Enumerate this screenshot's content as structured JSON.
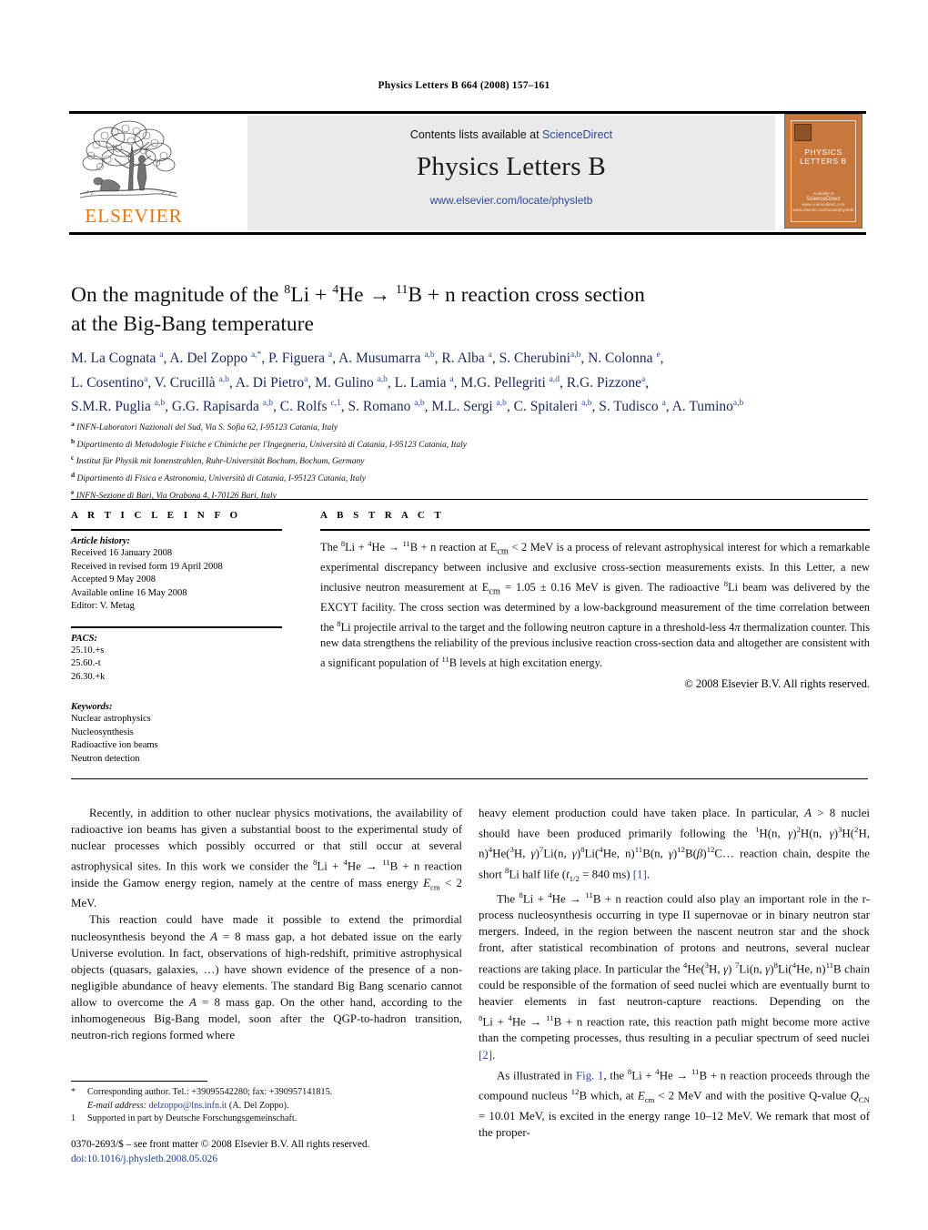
{
  "running_head": "Physics Letters B 664 (2008) 157–161",
  "masthead": {
    "publisher_name": "ELSEVIER",
    "contents_prefix": "Contents lists available at ",
    "contents_link": "ScienceDirect",
    "journal_title": "Physics Letters B",
    "journal_url": "www.elsevier.com/locate/physletb",
    "cover": {
      "title": "PHYSICS LETTERS B",
      "foot_line1": "Available at",
      "foot_line2": "ScienceDirect",
      "foot_line3": "www.sciencedirect.com",
      "foot_line4": "www.elsevier.com/locate/physletb"
    }
  },
  "article": {
    "title_line1_pre": "On the magnitude of the ",
    "title_line1_post": " reaction cross section",
    "title_line2": "at the Big-Bang temperature",
    "title_plain": "On the magnitude of the 8Li + 4He → 11B + n reaction cross section at the Big-Bang temperature"
  },
  "authors_line1": "M. La Cognata a, A. Del Zoppo a,*, P. Figuera a, A. Musumarra a,b, R. Alba a, S. Cherubini a,b, N. Colonna e,",
  "authors_line2": "L. Cosentino a, V. Crucillà a,b, A. Di Pietro a, M. Gulino a,b, L. Lamia a, M.G. Pellegriti a,d, R.G. Pizzone a,",
  "authors_line3": "S.M.R. Puglia a,b, G.G. Rapisarda a,b, C. Rolfs c,1, S. Romano a,b, M.L. Sergi a,b, C. Spitaleri a,b, S. Tudisco a, A. Tumino a,b",
  "affiliations": [
    {
      "mark": "a",
      "text": "INFN-Laboratori Nazionali del Sud, Via S. Sofia 62, I-95123 Catania, Italy"
    },
    {
      "mark": "b",
      "text": "Dipartimento di Metodologie Fisiche e Chimiche per l'Ingegneria, Università di Catania, I-95123 Catania, Italy"
    },
    {
      "mark": "c",
      "text": "Institut für Physik mit Ionenstrahlen, Ruhr-Universität Bochum, Bochum, Germany"
    },
    {
      "mark": "d",
      "text": "Dipartimento di Fisica e Astronomia, Università di Catania, I-95123 Catania, Italy"
    },
    {
      "mark": "e",
      "text": "INFN-Sezione di Bari, Via Orabona 4, I-70126 Bari, Italy"
    }
  ],
  "article_info": {
    "heading": "A R T I C L E   I N F O",
    "history_head": "Article history:",
    "history": [
      "Received 16 January 2008",
      "Received in revised form 19 April 2008",
      "Accepted 9 May 2008",
      "Available online 16 May 2008",
      "Editor: V. Metag"
    ],
    "pacs_head": "PACS:",
    "pacs": [
      "25.10.+s",
      "25.60.-t",
      "26.30.+k"
    ],
    "keywords_head": "Keywords:",
    "keywords": [
      "Nuclear astrophysics",
      "Nucleosynthesis",
      "Radioactive ion beams",
      "Neutron detection"
    ]
  },
  "abstract": {
    "heading": "A B S T R A C T",
    "copyright": "© 2008 Elsevier B.V. All rights reserved."
  },
  "footnotes": {
    "star_mark": "*",
    "star_text": "Corresponding author. Tel.: +39095542280; fax: +390957141815.",
    "email_label": "E-mail address:",
    "email": "delzoppo@lns.infn.it",
    "email_owner": "(A. Del Zoppo).",
    "one_mark": "1",
    "one_text": "Supported in part by Deutsche Forschungsgemeinschaft."
  },
  "footer": {
    "issn_line": "0370-2693/$ – see front matter  © 2008 Elsevier B.V. All rights reserved.",
    "doi": "doi:10.1016/j.physletb.2008.05.026"
  },
  "colors": {
    "elsevier_orange": "#e8740c",
    "link_blue": "#2b4a9b",
    "author_navy": "#1b2a58",
    "band_gray": "#eaeaea",
    "cover_orange": "#c8773d"
  }
}
